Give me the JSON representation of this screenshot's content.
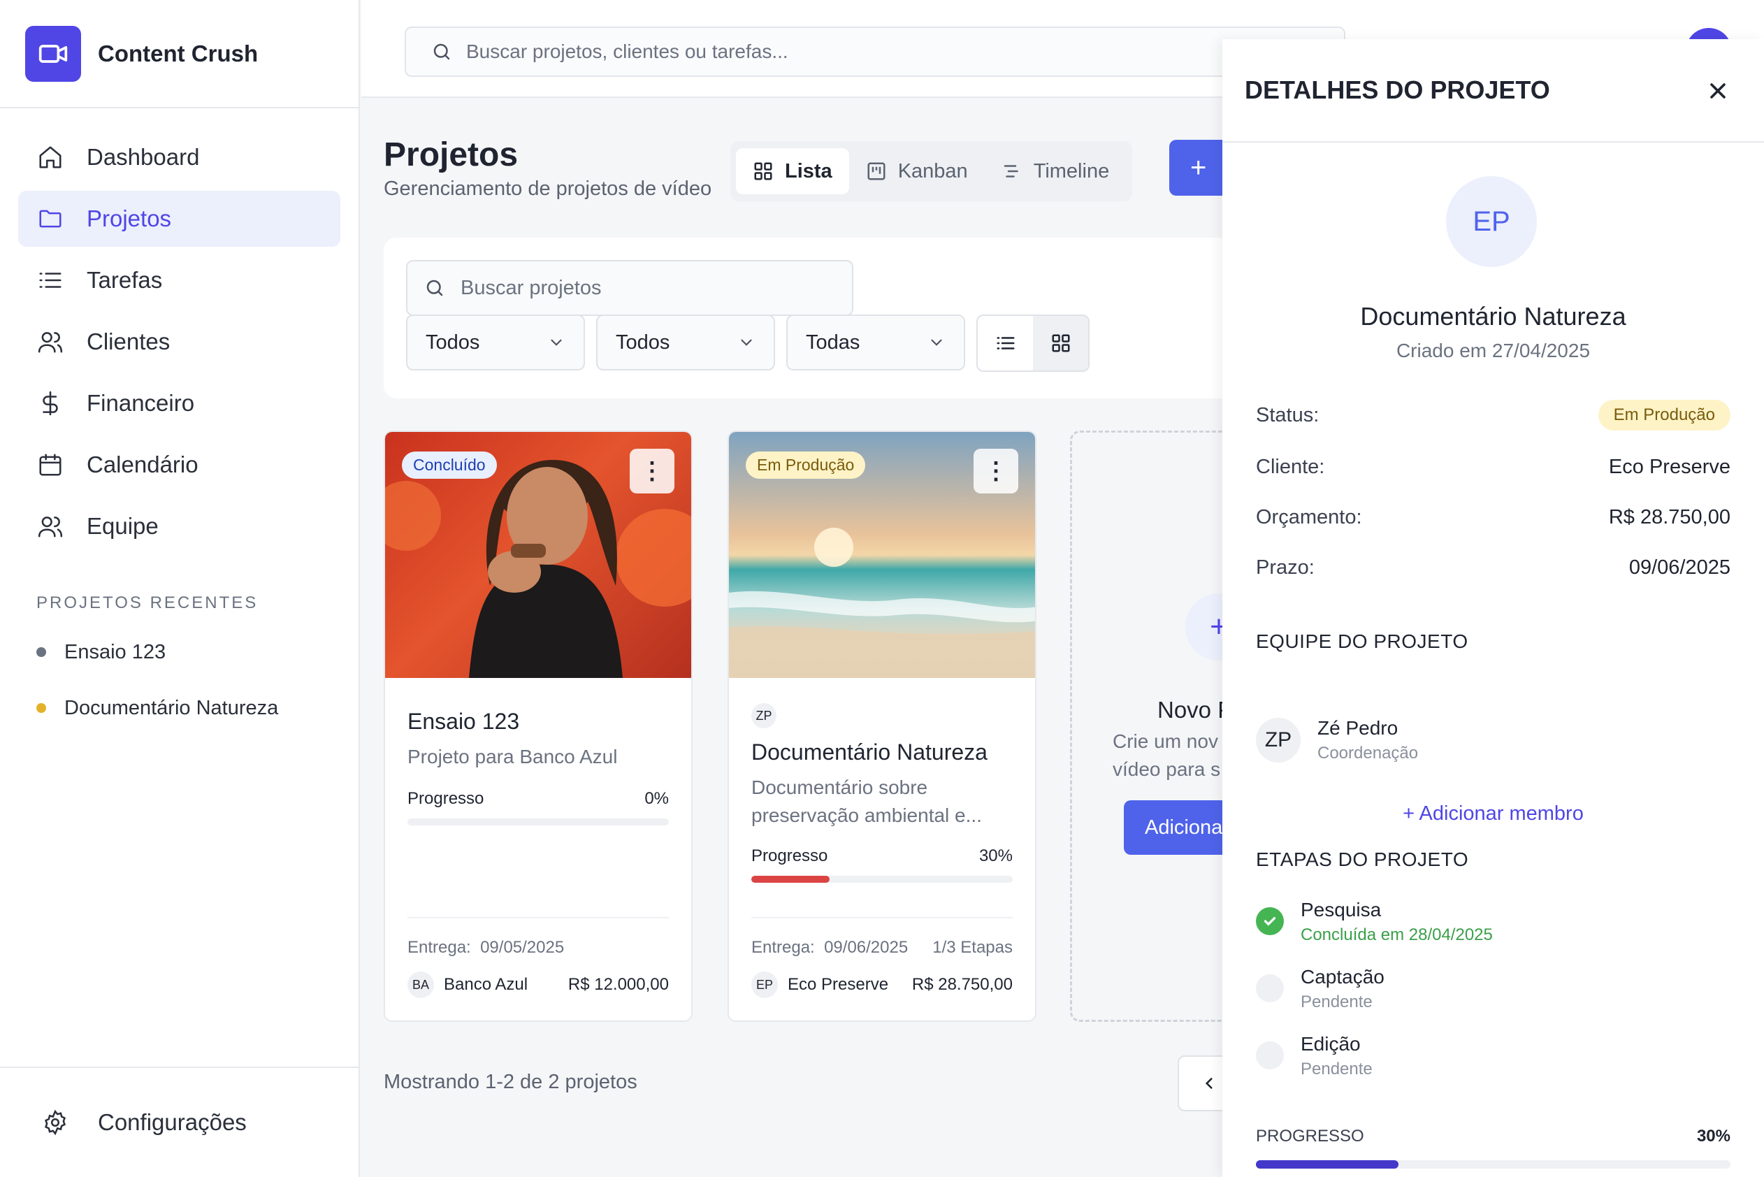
{
  "brand": {
    "name": "Content Crush",
    "accent": "#4f46e5"
  },
  "sidebar": {
    "items": [
      {
        "label": "Dashboard",
        "icon": "home-icon"
      },
      {
        "label": "Projetos",
        "icon": "folder-icon",
        "active": true
      },
      {
        "label": "Tarefas",
        "icon": "list-icon"
      },
      {
        "label": "Clientes",
        "icon": "users-icon"
      },
      {
        "label": "Financeiro",
        "icon": "dollar-icon"
      },
      {
        "label": "Calendário",
        "icon": "calendar-icon"
      },
      {
        "label": "Equipe",
        "icon": "team-icon"
      }
    ],
    "recent_title": "PROJETOS RECENTES",
    "recent": [
      {
        "label": "Ensaio 123",
        "color": "#6b7280"
      },
      {
        "label": "Documentário Natureza",
        "color": "#e3b22a"
      }
    ],
    "settings_label": "Configurações"
  },
  "topbar": {
    "search_placeholder": "Buscar projetos, clientes ou tarefas..."
  },
  "main": {
    "title": "Projetos",
    "subtitle": "Gerenciamento de projetos de vídeo",
    "view_tabs": [
      "Lista",
      "Kanban",
      "Timeline"
    ],
    "new_button": "+",
    "filters": {
      "search_placeholder": "Buscar projetos",
      "selects": [
        "Todos",
        "Todos",
        "Todas"
      ]
    },
    "cards": [
      {
        "badge": "Concluído",
        "badge_colors": {
          "bg": "#e8efff",
          "fg": "#1e40af"
        },
        "title": "Ensaio 123",
        "description": "Projeto para Banco Azul",
        "progress_label": "Progresso",
        "progress_text": "0%",
        "progress": 0,
        "progress_color": "#ef4444",
        "delivery_label": "Entrega:",
        "delivery_date": "09/05/2025",
        "stages": "",
        "client_initials": "BA",
        "client": "Banco Azul",
        "budget": "R$ 12.000,00"
      },
      {
        "badge": "Em Produção",
        "badge_colors": {
          "bg": "#fdf3c7",
          "fg": "#7a5b0b"
        },
        "avatar": "ZP",
        "title": "Documentário Natureza",
        "description": "Documentário sobre preservação ambiental e...",
        "progress_label": "Progresso",
        "progress_text": "30%",
        "progress": 30,
        "progress_color": "#dc4444",
        "delivery_label": "Entrega:",
        "delivery_date": "09/06/2025",
        "stages": "1/3 Etapas",
        "client_initials": "EP",
        "client": "Eco Preserve",
        "budget": "R$ 28.750,00"
      }
    ],
    "new_card": {
      "title": "Novo P",
      "desc_line1": "Crie um nov",
      "desc_line2": "vídeo para s",
      "button": "Adiciona"
    },
    "pager_text": "Mostrando 1-2 de 2 projetos"
  },
  "panel": {
    "title": "DETALHES DO PROJETO",
    "avatar": "EP",
    "project_name": "Documentário Natureza",
    "created": "Criado em 27/04/2025",
    "fields": [
      {
        "label": "Status:",
        "value": "Em Produção",
        "pill": true
      },
      {
        "label": "Cliente:",
        "value": "Eco Preserve"
      },
      {
        "label": "Orçamento:",
        "value": "R$ 28.750,00"
      },
      {
        "label": "Prazo:",
        "value": "09/06/2025"
      }
    ],
    "team_title": "EQUIPE DO PROJETO",
    "member": {
      "initials": "ZP",
      "name": "Zé Pedro",
      "role": "Coordenação"
    },
    "add_member": "+ Adicionar membro",
    "stages_title": "ETAPAS DO PROJETO",
    "stages": [
      {
        "name": "Pesquisa",
        "sub": "Concluída em 28/04/2025",
        "done": true
      },
      {
        "name": "Captação",
        "sub": "Pendente",
        "done": false
      },
      {
        "name": "Edição",
        "sub": "Pendente",
        "done": false
      }
    ],
    "progress_label": "PROGRESSO",
    "progress_text": "30%",
    "progress": 30
  }
}
